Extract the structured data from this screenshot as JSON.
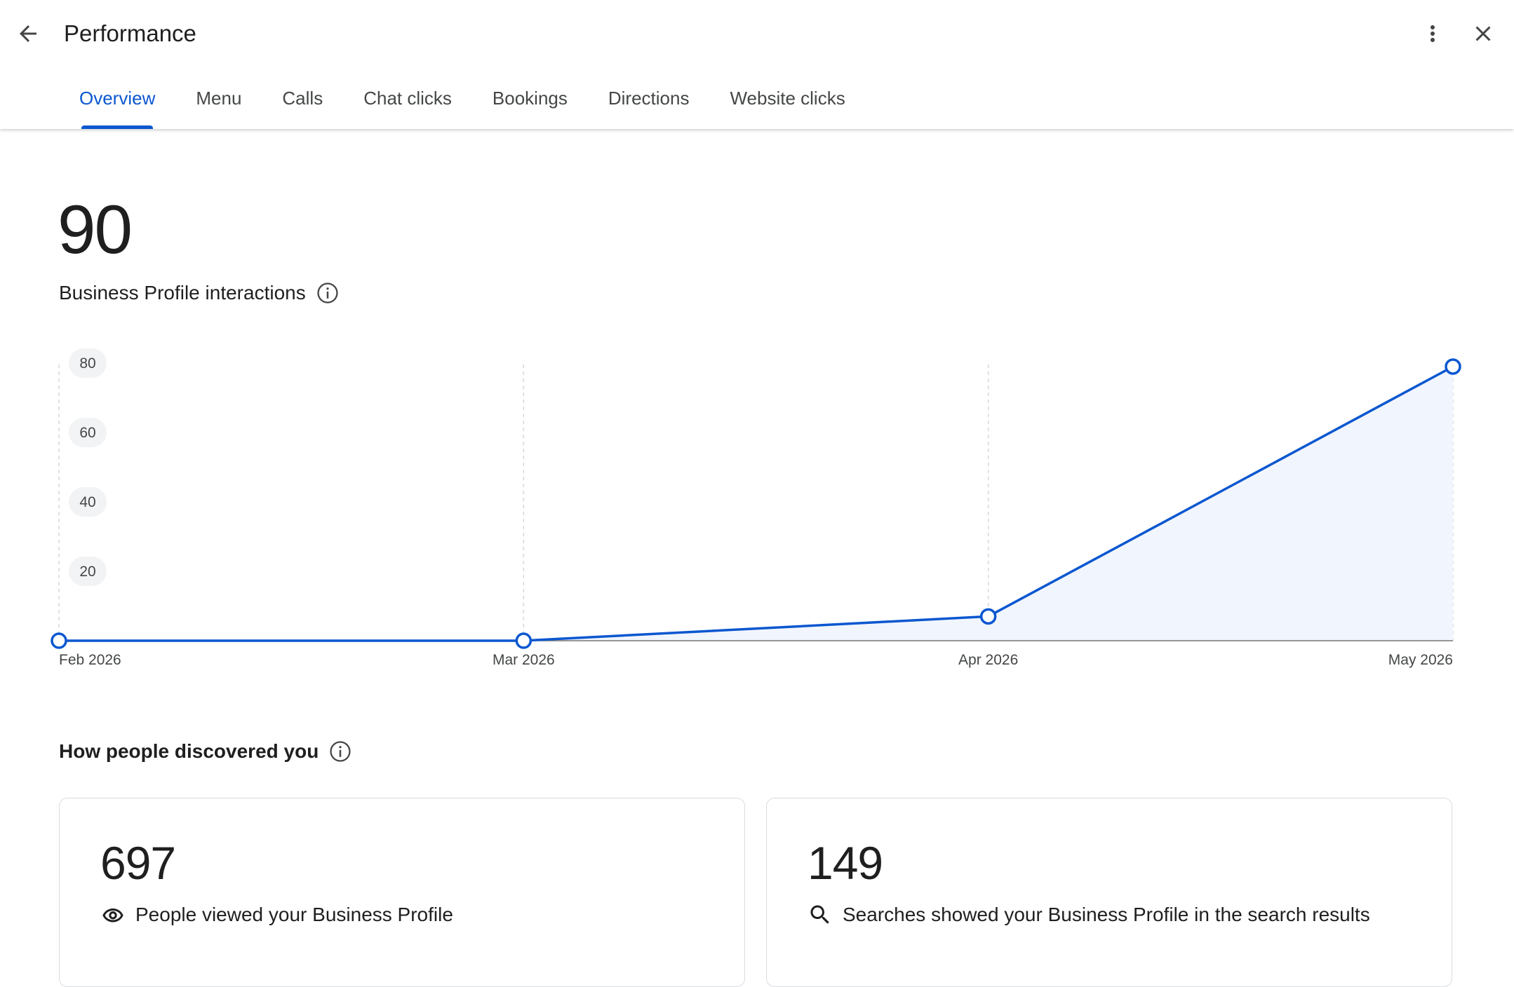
{
  "header": {
    "title": "Performance",
    "back_icon": "arrow-back-icon",
    "more_icon": "more-vert-icon",
    "close_icon": "close-icon"
  },
  "tabs": [
    {
      "label": "Overview",
      "active": true
    },
    {
      "label": "Menu",
      "active": false
    },
    {
      "label": "Calls",
      "active": false
    },
    {
      "label": "Chat clicks",
      "active": false
    },
    {
      "label": "Bookings",
      "active": false
    },
    {
      "label": "Directions",
      "active": false
    },
    {
      "label": "Website clicks",
      "active": false
    }
  ],
  "summary": {
    "value": "90",
    "label": "Business Profile interactions",
    "info_icon": "info-icon"
  },
  "chart_data": {
    "type": "area",
    "x": [
      "Feb 2026",
      "Mar 2026",
      "Apr 2026",
      "May 2026"
    ],
    "series": [
      {
        "values": [
          0,
          0,
          7,
          79
        ]
      }
    ],
    "yticks": [
      20,
      40,
      60,
      80
    ],
    "ylim": [
      0,
      80
    ],
    "grid": "vertical dashed",
    "colors": {
      "line": "#0b57d0",
      "fill": "#f1f5fd"
    }
  },
  "discovery": {
    "title": "How people discovered you",
    "info_icon": "info-icon",
    "cards": [
      {
        "value": "697",
        "label": "People viewed your Business Profile",
        "icon": "eye-icon"
      },
      {
        "value": "149",
        "label": "Searches showed your Business Profile in the search results",
        "icon": "search-icon"
      }
    ]
  },
  "colors": {
    "accent": "#0b57d0",
    "text": "#1f1f1f",
    "muted": "#444746"
  }
}
